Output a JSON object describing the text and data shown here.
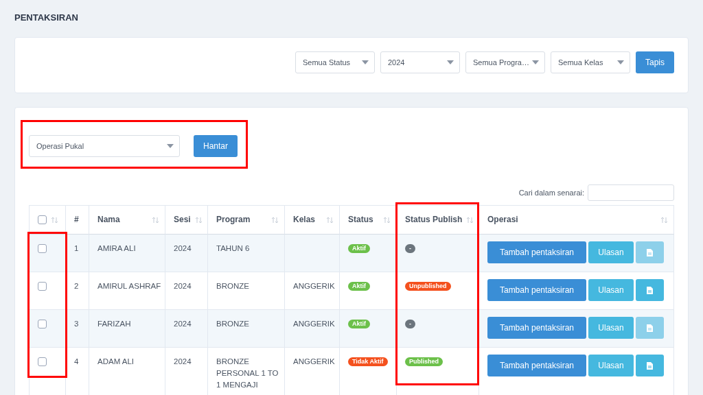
{
  "page_title": "PENTAKSIRAN",
  "filters": [
    {
      "value": "Semua Status"
    },
    {
      "value": "2024"
    },
    {
      "value": "Semua Progra…"
    },
    {
      "value": "Semua Kelas"
    }
  ],
  "filter_button": "Tapis",
  "bulk": {
    "value": "Operasi Pukal",
    "button": "Hantar"
  },
  "search": {
    "label": "Cari dalam senarai:"
  },
  "table": {
    "select_all": {
      "checked": false
    },
    "columns": [
      {
        "label": "#",
        "sortable": false
      },
      {
        "label": "Nama",
        "sortable": true
      },
      {
        "label": "Sesi",
        "sortable": true
      },
      {
        "label": "Program",
        "sortable": true
      },
      {
        "label": "Kelas",
        "sortable": true
      },
      {
        "label": "Status",
        "sortable": true
      },
      {
        "label": "Status Publish",
        "sortable": true
      },
      {
        "label": "Operasi",
        "sortable": true
      }
    ],
    "rows": [
      {
        "checked": false,
        "no": "1",
        "nama": "AMIRA ALI",
        "sesi": "2024",
        "program": "TAHUN 6",
        "kelas": "",
        "status": {
          "kind": "active",
          "text": "Aktif"
        },
        "publish": {
          "kind": "none",
          "text": "-"
        },
        "add": "Tambah pentaksiran",
        "review": "Ulasan",
        "doc_disabled": true
      },
      {
        "checked": false,
        "no": "2",
        "nama": "AMIRUL ASHRAF",
        "sesi": "2024",
        "program": "BRONZE",
        "kelas": "ANGGERIK",
        "status": {
          "kind": "active",
          "text": "Aktif"
        },
        "publish": {
          "kind": "unpublished",
          "text": "Unpublished"
        },
        "add": "Tambah pentaksiran",
        "review": "Ulasan",
        "doc_disabled": false
      },
      {
        "checked": false,
        "no": "3",
        "nama": "FARIZAH",
        "sesi": "2024",
        "program": "BRONZE",
        "kelas": "ANGGERIK",
        "status": {
          "kind": "active",
          "text": "Aktif"
        },
        "publish": {
          "kind": "none",
          "text": "-"
        },
        "add": "Tambah pentaksiran",
        "review": "Ulasan",
        "doc_disabled": true
      },
      {
        "checked": false,
        "no": "4",
        "nama": "ADAM ALI",
        "sesi": "2024",
        "program": "BRONZE PERSONAL 1 TO 1 MENGAJI",
        "kelas": "ANGGERIK",
        "status": {
          "kind": "inactive",
          "text": "Tidak Aktif"
        },
        "publish": {
          "kind": "published",
          "text": "Published"
        },
        "add": "Tambah pentaksiran",
        "review": "Ulasan",
        "doc_disabled": false
      }
    ]
  }
}
